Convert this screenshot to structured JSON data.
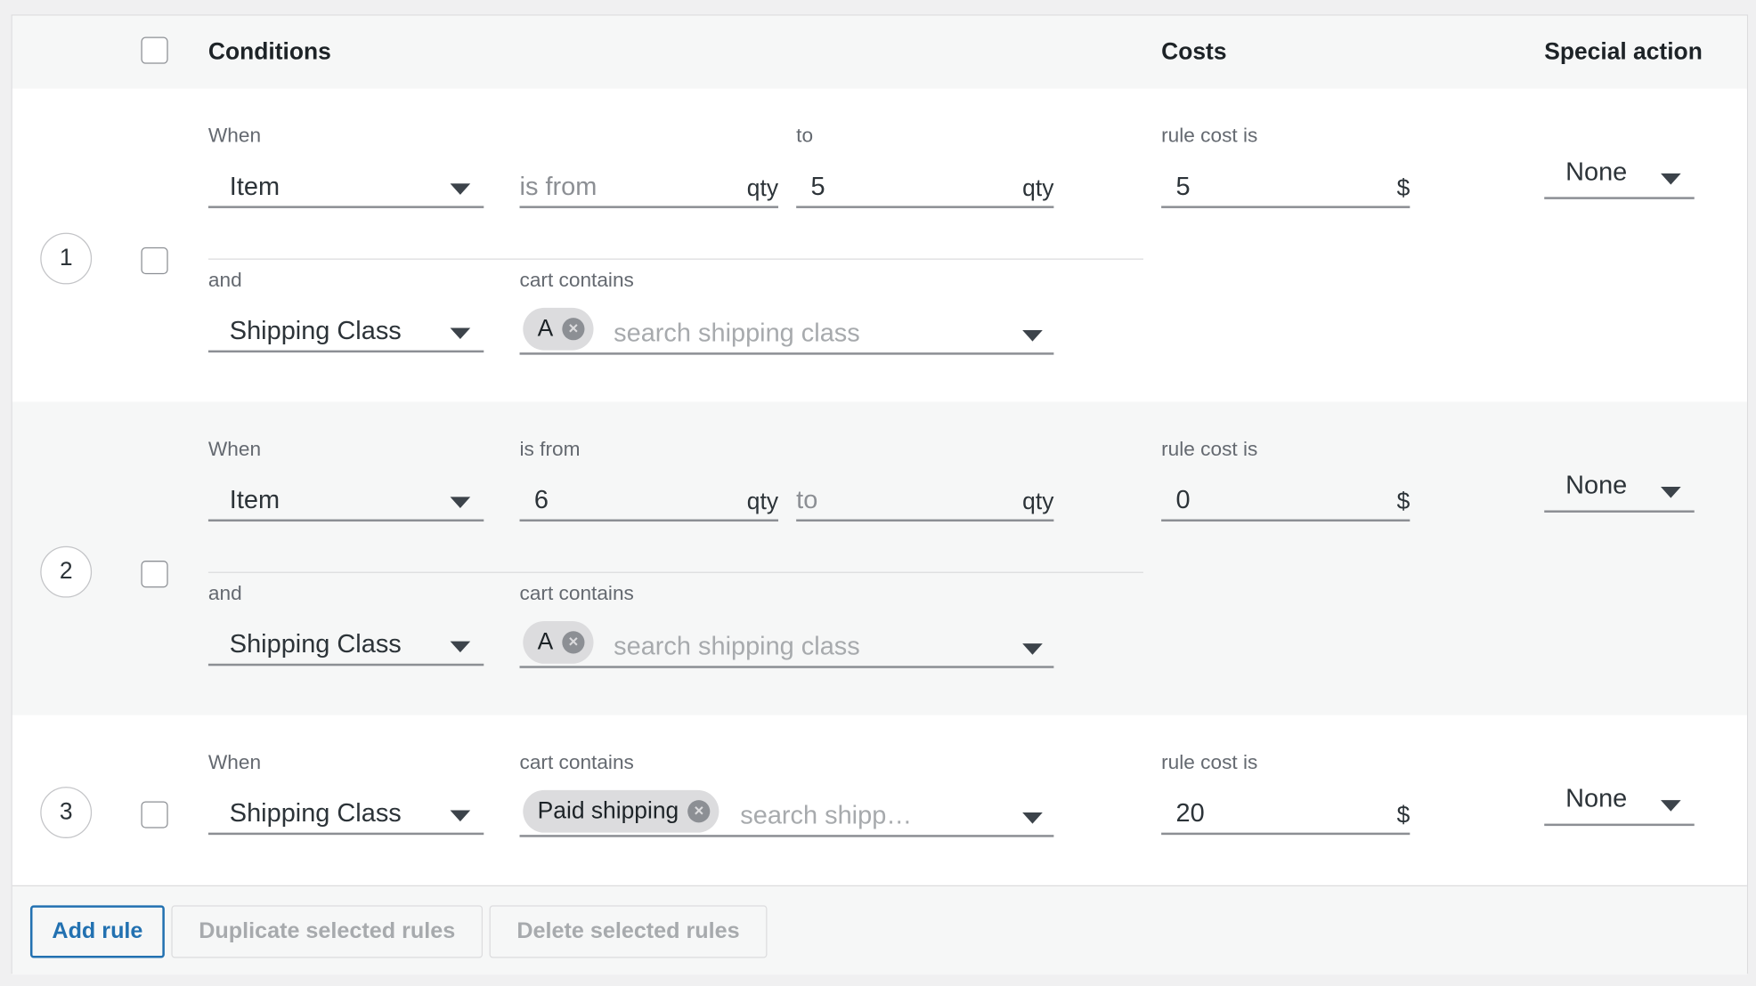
{
  "header": {
    "conditions": "Conditions",
    "costs": "Costs",
    "special_action": "Special action"
  },
  "rules": [
    {
      "number": "1",
      "when_label": "When",
      "when_value": "Item",
      "from_placeholder": "is from",
      "from_unit": "qty",
      "to_label": "to",
      "to_value": "5",
      "to_unit": "qty",
      "and_label": "and",
      "and_value": "Shipping Class",
      "contains_label": "cart contains",
      "chip": "A",
      "search_placeholder": "search shipping class",
      "cost_label": "rule cost is",
      "cost_value": "5",
      "currency": "$",
      "special": "None"
    },
    {
      "number": "2",
      "when_label": "When",
      "when_value": "Item",
      "from_label": "is from",
      "from_value": "6",
      "from_unit": "qty",
      "to_placeholder": "to",
      "to_unit": "qty",
      "and_label": "and",
      "and_value": "Shipping Class",
      "contains_label": "cart contains",
      "chip": "A",
      "search_placeholder": "search shipping class",
      "cost_label": "rule cost is",
      "cost_value": "0",
      "currency": "$",
      "special": "None"
    },
    {
      "number": "3",
      "when_label": "When",
      "when_value": "Shipping Class",
      "contains_label": "cart contains",
      "chip": "Paid shipping",
      "search_placeholder": "search shipp…",
      "cost_label": "rule cost is",
      "cost_value": "20",
      "currency": "$",
      "special": "None"
    }
  ],
  "footer": {
    "add": "Add rule",
    "duplicate": "Duplicate selected rules",
    "delete": "Delete selected rules"
  },
  "colors": {
    "accent": "#2271b1",
    "alt_row": "#f6f7f7",
    "chip": "#dcdcde"
  }
}
